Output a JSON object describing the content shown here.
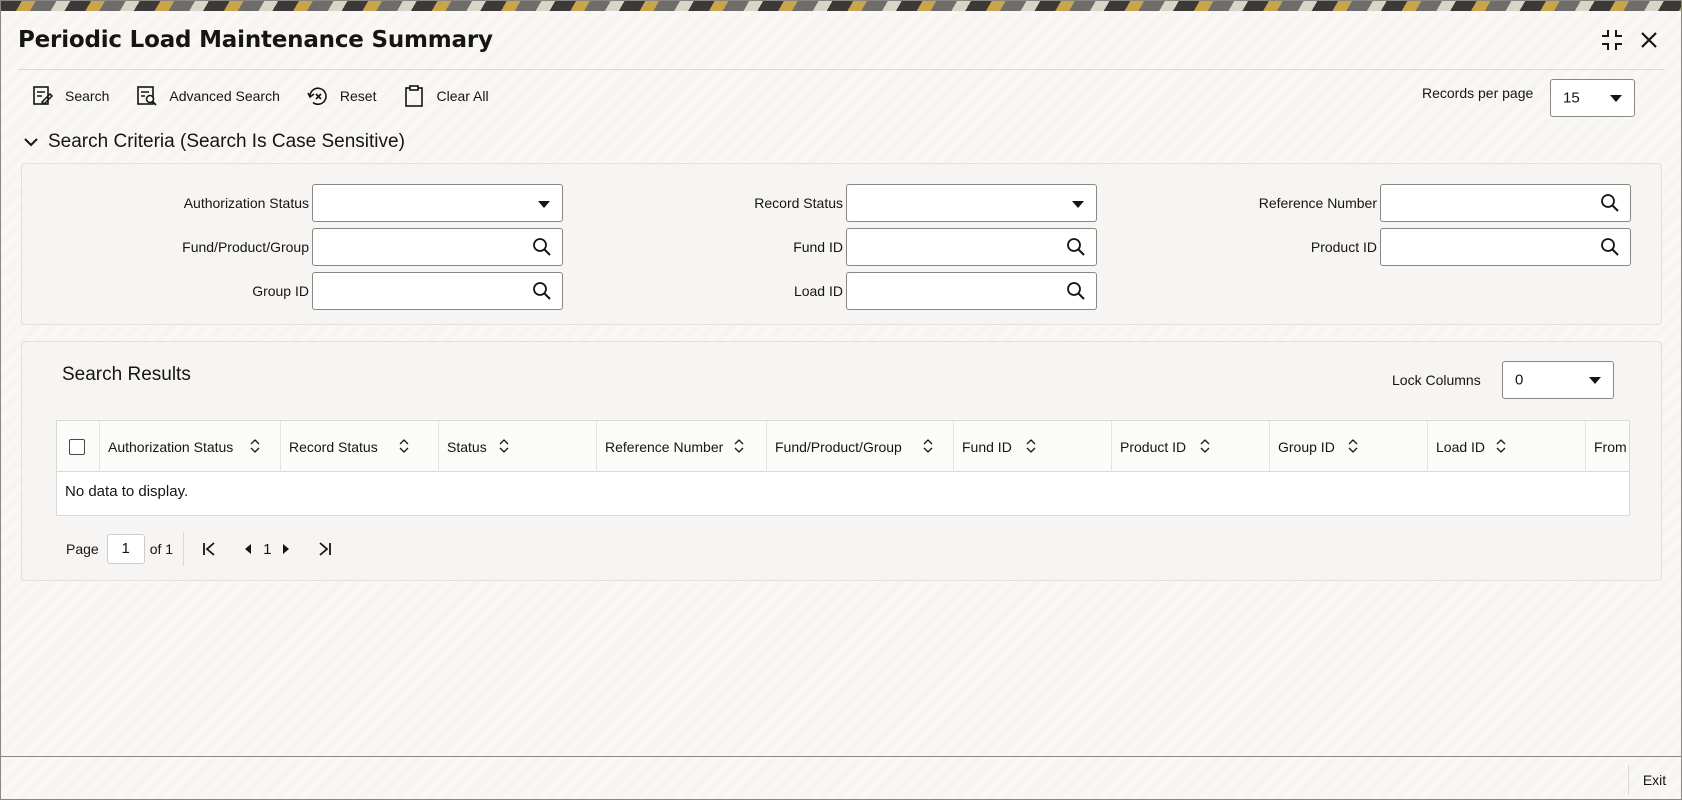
{
  "window": {
    "title": "Periodic Load Maintenance Summary"
  },
  "icons": {
    "maximize": "minimize-corners-icon",
    "close": "close-icon"
  },
  "toolbar": {
    "search": "Search",
    "advanced_search": "Advanced Search",
    "reset": "Reset",
    "clear_all": "Clear All",
    "records_per_page_label": "Records per page",
    "records_per_page_value": "15"
  },
  "criteria": {
    "title": "Search Criteria (Search Is Case Sensitive)",
    "fields": {
      "authorization_status": "Authorization Status",
      "record_status": "Record Status",
      "reference_number": "Reference Number",
      "fund_product_group": "Fund/Product/Group",
      "fund_id": "Fund ID",
      "product_id": "Product ID",
      "group_id": "Group ID",
      "load_id": "Load ID"
    }
  },
  "results": {
    "title": "Search Results",
    "lock_columns_label": "Lock Columns",
    "lock_columns_value": "0",
    "columns": [
      "Authorization Status",
      "Record Status",
      "Status",
      "Reference Number",
      "Fund/Product/Group",
      "Fund ID",
      "Product ID",
      "Group ID",
      "Load ID",
      "From"
    ],
    "empty_message": "No data to display."
  },
  "pager": {
    "page_label": "Page",
    "page_value": "1",
    "of_label": "of 1",
    "current": "1"
  },
  "footer": {
    "exit": "Exit"
  }
}
